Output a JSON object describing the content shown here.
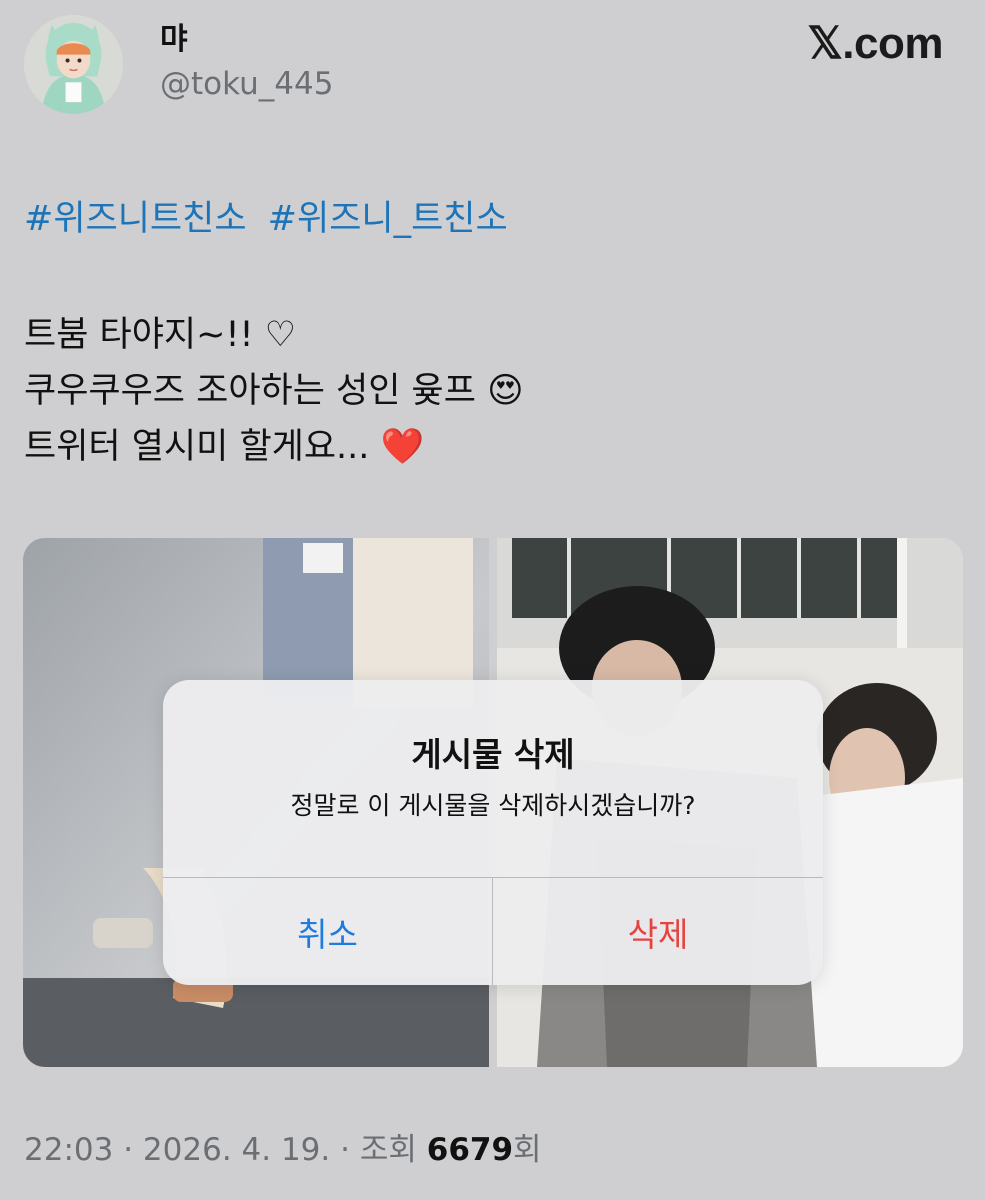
{
  "author": {
    "display_name": "먀",
    "handle": "@toku_445"
  },
  "brand": "𝕏.com",
  "tweet": {
    "hashtags": [
      "#위즈니트친소",
      "#위즈니_트친소"
    ],
    "lines": [
      "트붐 타야지~!! ♡",
      "쿠우쿠우즈 조아하는 성인 윶프 😍",
      "트위터 열시미 할게요... ❤️"
    ]
  },
  "dialog": {
    "title": "게시물 삭제",
    "message": "정말로 이 게시물을 삭제하시겠습니까?",
    "cancel_label": "취소",
    "delete_label": "삭제",
    "cancel_color": "#1e7ce0",
    "delete_color": "#e5433f"
  },
  "meta": {
    "time": "22:03",
    "date": "2026. 4. 19.",
    "views_prefix": "조회",
    "views_count": "6679",
    "views_suffix": "회"
  },
  "colors": {
    "background": "#cfcfd1",
    "hashtag": "#1d74b8",
    "secondary_text": "#6b6f74"
  }
}
